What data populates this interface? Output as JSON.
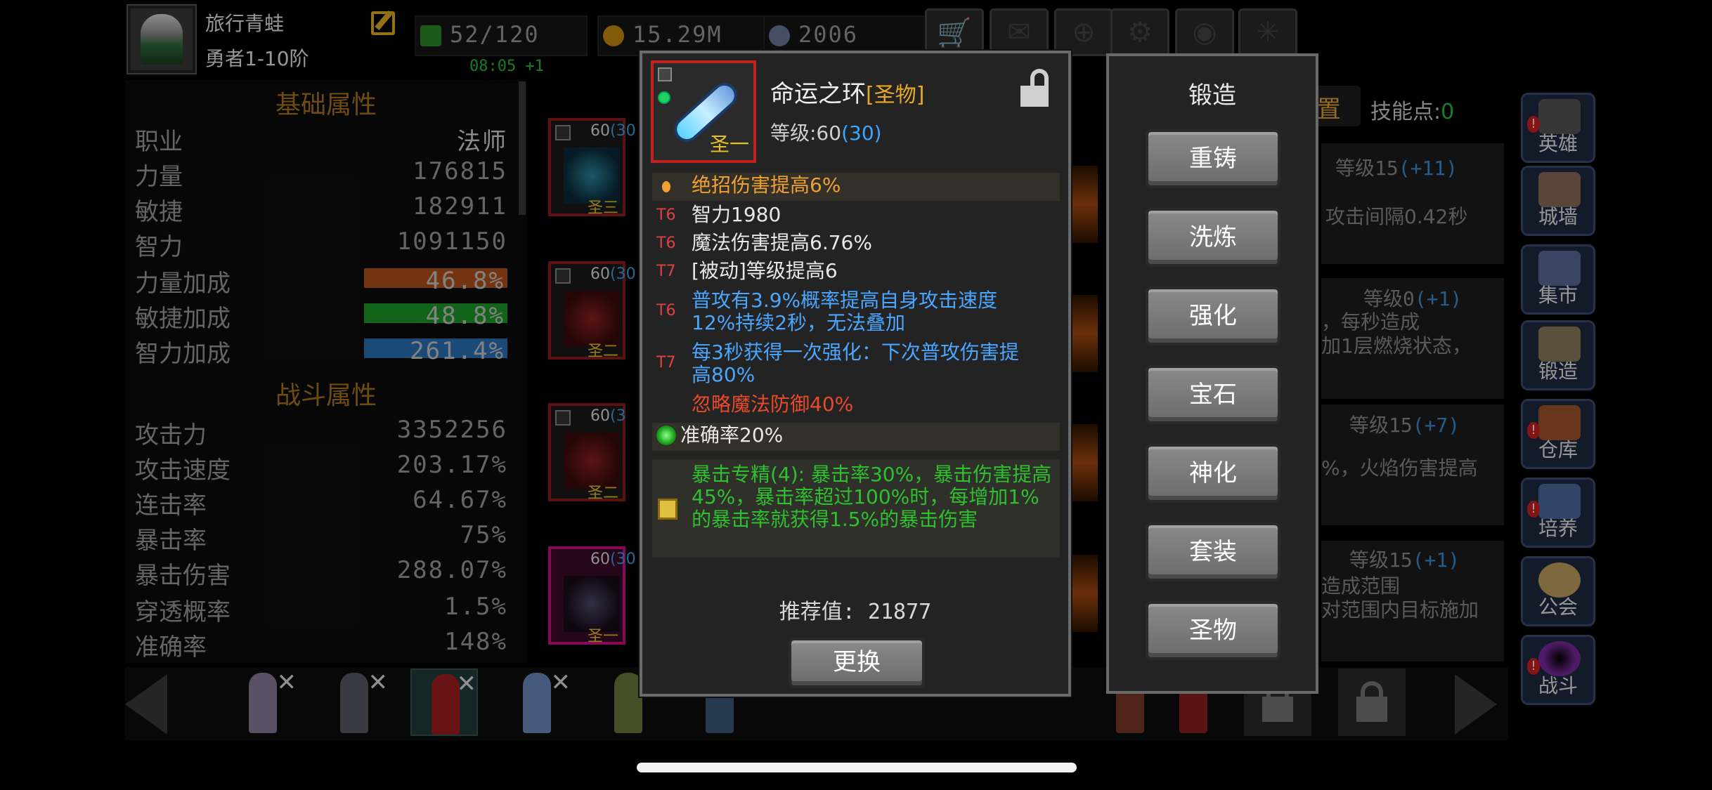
{
  "player": {
    "name": "旅行青蛙",
    "rank": "勇者1-10阶"
  },
  "stats": {
    "energy": "52/120",
    "gold": "15.29M",
    "gems": "2006",
    "timer": "08:05 +1"
  },
  "colors": {
    "gold": "#f0a030",
    "blue": "#4aa6ff",
    "red": "#e84a2a",
    "green": "#2ec02e"
  },
  "base_attrs": {
    "title": "基础属性",
    "rows": [
      {
        "k": "职业",
        "v": "法师"
      },
      {
        "k": "力量",
        "v": "176815"
      },
      {
        "k": "敏捷",
        "v": "182911"
      },
      {
        "k": "智力",
        "v": "1091150"
      }
    ],
    "bars": [
      {
        "k": "力量加成",
        "v": "46.8%",
        "color": "#b4501a",
        "fill_pct": 46.8
      },
      {
        "k": "敏捷加成",
        "v": "48.8%",
        "color": "#1e9a2a",
        "fill_pct": 48.8
      },
      {
        "k": "智力加成",
        "v": "261.4%",
        "color": "#2a70b8",
        "fill_pct": 100
      }
    ]
  },
  "combat_attrs": {
    "title": "战斗属性",
    "rows": [
      {
        "k": "攻击力",
        "v": "3352256"
      },
      {
        "k": "攻击速度",
        "v": "203.17%"
      },
      {
        "k": "连击率",
        "v": "64.67%"
      },
      {
        "k": "暴击率",
        "v": "75%"
      },
      {
        "k": "暴击伤害",
        "v": "288.07%"
      },
      {
        "k": "穿透概率",
        "v": "1.5%"
      },
      {
        "k": "准确率",
        "v": "148%"
      }
    ]
  },
  "equip_slots": [
    {
      "lvl": "60",
      "plus": "(30",
      "tier": "圣三"
    },
    {
      "lvl": "60",
      "plus": "(30",
      "tier": "圣二"
    },
    {
      "lvl": "60",
      "plus": "(3",
      "tier": "圣二"
    },
    {
      "lvl": "60",
      "plus": "(30",
      "tier": "圣一"
    }
  ],
  "skills": {
    "points_label": "技能点:",
    "points": "0",
    "tab_fragment": "置",
    "cards": [
      {
        "lvl": "等级15",
        "plus": "(+11)",
        "desc": "攻击间隔0.42秒"
      },
      {
        "lvl": "等级0",
        "plus": "(+1)",
        "desc": "，每秒造成\n加1层燃烧状态，"
      },
      {
        "lvl": "等级15",
        "plus": "(+7)",
        "desc": "%，火焰伤害提高"
      },
      {
        "lvl": "等级15",
        "plus": "(+1)",
        "desc": "造成范围\n对范围内目标施加"
      }
    ]
  },
  "side_menu": [
    {
      "label": "英雄",
      "icon": "helmet-icon",
      "alert": true
    },
    {
      "label": "城墙",
      "icon": "wall-icon",
      "alert": false
    },
    {
      "label": "集市",
      "icon": "market-icon",
      "alert": false
    },
    {
      "label": "锻造",
      "icon": "anvil-icon",
      "alert": false
    },
    {
      "label": "仓库",
      "icon": "warehouse-icon",
      "alert": true
    },
    {
      "label": "培养",
      "icon": "train-icon",
      "alert": true
    },
    {
      "label": "公会",
      "icon": "guild-icon",
      "alert": false
    },
    {
      "label": "战斗",
      "icon": "portal-icon",
      "alert": true
    }
  ],
  "item": {
    "name": "命运之环",
    "quality": "[圣物]",
    "tier": "圣一",
    "level_label": "等级:60",
    "level_bonus": "(30)",
    "lines": [
      {
        "tag": "",
        "text": "绝招伤害提高6%",
        "cls": "c-gold",
        "hl": true,
        "orb": true
      },
      {
        "tag": "T6",
        "text": "智力1980",
        "cls": "c-white"
      },
      {
        "tag": "T6",
        "text": "魔法伤害提高6.76%",
        "cls": "c-white"
      },
      {
        "tag": "T7",
        "text": "[被动]等级提高6",
        "cls": "c-white"
      },
      {
        "tag": "T6",
        "text": "普攻有3.9%概率提高自身攻击速度\n12%持续2秒，无法叠加",
        "cls": "c-blue",
        "tall": true
      },
      {
        "tag": "T7",
        "text": "每3秒获得一次强化：下次普攻伤害提\n高80%",
        "cls": "c-blue",
        "tall": true
      },
      {
        "tag": "",
        "text": "忽略魔法防御40%",
        "cls": "c-red"
      }
    ],
    "socket": "准确率20%",
    "description": "暴击专精(4): 暴击率30%，暴击伤害提高45%，暴击率超过100%时，每增加1%的暴击率就获得1.5%的暴击伤害",
    "recommend": "推荐值: 21877",
    "change_label": "更换"
  },
  "forge": {
    "title": "锻造",
    "buttons": [
      "重铸",
      "洗炼",
      "强化",
      "宝石",
      "神化",
      "套装",
      "圣物"
    ]
  }
}
